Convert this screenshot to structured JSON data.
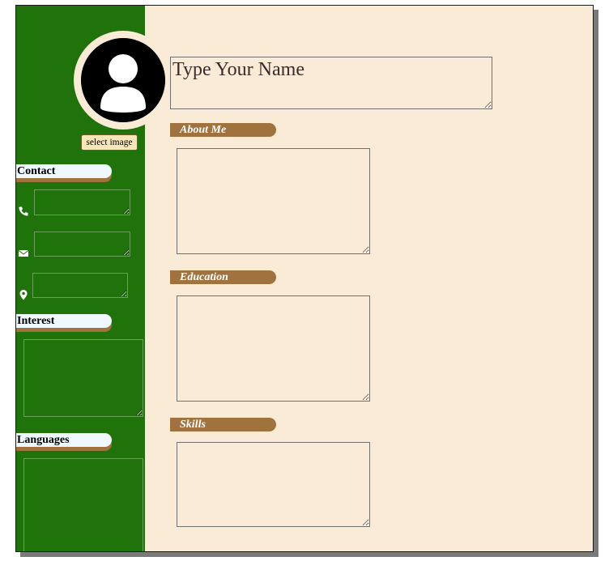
{
  "header": {
    "name_placeholder": "Type Your Name"
  },
  "sidebar": {
    "select_image_label": "select image",
    "contact_heading": "Contact",
    "interest_heading": "Interest",
    "languages_heading": "Languages",
    "icons": [
      "phone-icon",
      "mail-icon",
      "location-icon"
    ]
  },
  "sections": {
    "about_label": "About Me",
    "education_label": "Education",
    "skills_label": "Skills"
  },
  "colors": {
    "sidebar_green": "#20720a",
    "page_bg": "#faebd7",
    "pill_brown": "#a0733e",
    "heading_bg": "#f0f8ff"
  }
}
